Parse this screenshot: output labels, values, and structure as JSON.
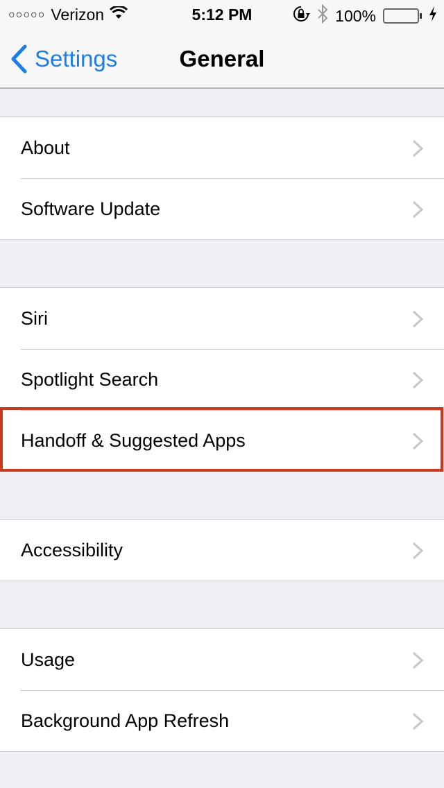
{
  "status_bar": {
    "signal_dots": "○○○○○",
    "carrier": "Verizon",
    "time": "5:12 PM",
    "battery_percent": "100%",
    "battery_level": 1.0,
    "icons": [
      "wifi-icon",
      "rotation-lock-icon",
      "bluetooth-icon",
      "battery-icon",
      "charging-icon"
    ]
  },
  "nav": {
    "back_label": "Settings",
    "title": "General"
  },
  "groups": [
    {
      "items": [
        {
          "label": "About"
        },
        {
          "label": "Software Update"
        }
      ]
    },
    {
      "items": [
        {
          "label": "Siri"
        },
        {
          "label": "Spotlight Search"
        },
        {
          "label": "Handoff & Suggested Apps",
          "highlighted": true
        }
      ]
    },
    {
      "items": [
        {
          "label": "Accessibility"
        }
      ]
    },
    {
      "items": [
        {
          "label": "Usage"
        },
        {
          "label": "Background App Refresh"
        }
      ]
    }
  ],
  "colors": {
    "accent": "#1a7ee6",
    "highlight_border": "#c9371f",
    "battery_fill": "#4cd964",
    "background": "#efeff4"
  }
}
